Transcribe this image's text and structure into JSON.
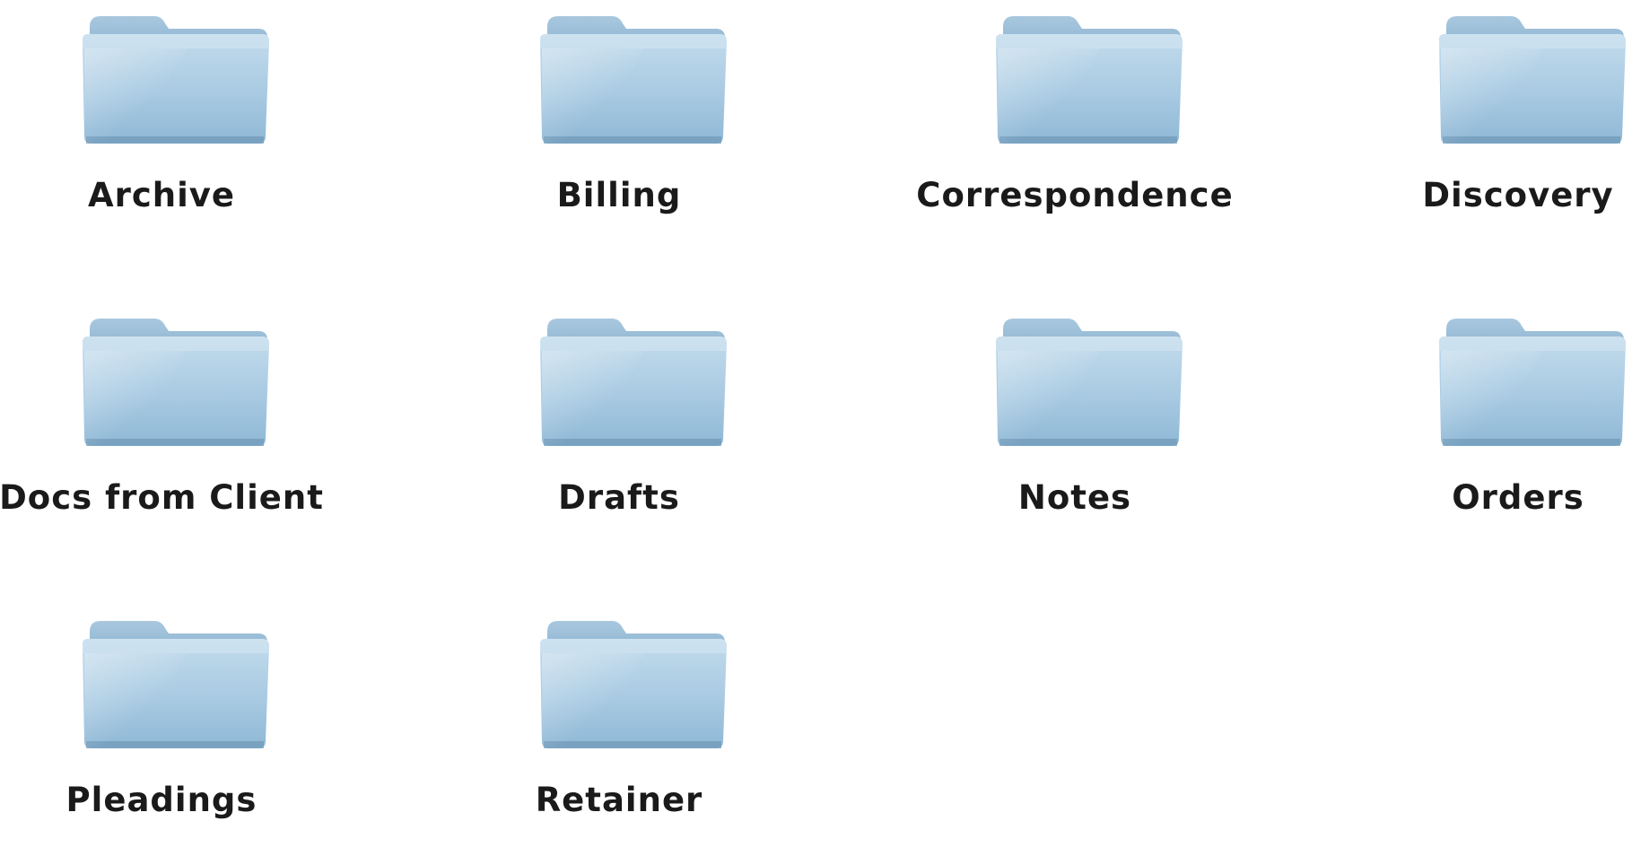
{
  "window": {
    "view": "icon-view"
  },
  "colors": {
    "background": "#ffffff",
    "folder_light": "#bcd6e8",
    "folder_mid": "#9cc2dd",
    "folder_dark": "#7fa9c8",
    "label_text": "#1a1a1a"
  },
  "folders": [
    {
      "label": "Archive",
      "icon": "folder-icon"
    },
    {
      "label": "Billing",
      "icon": "folder-icon"
    },
    {
      "label": "Correspondence",
      "icon": "folder-icon"
    },
    {
      "label": "Discovery",
      "icon": "folder-icon"
    },
    {
      "label": "Docs from Client",
      "icon": "folder-icon"
    },
    {
      "label": "Drafts",
      "icon": "folder-icon"
    },
    {
      "label": "Notes",
      "icon": "folder-icon"
    },
    {
      "label": "Orders",
      "icon": "folder-icon"
    },
    {
      "label": "Pleadings",
      "icon": "folder-icon"
    },
    {
      "label": "Retainer",
      "icon": "folder-icon"
    }
  ]
}
